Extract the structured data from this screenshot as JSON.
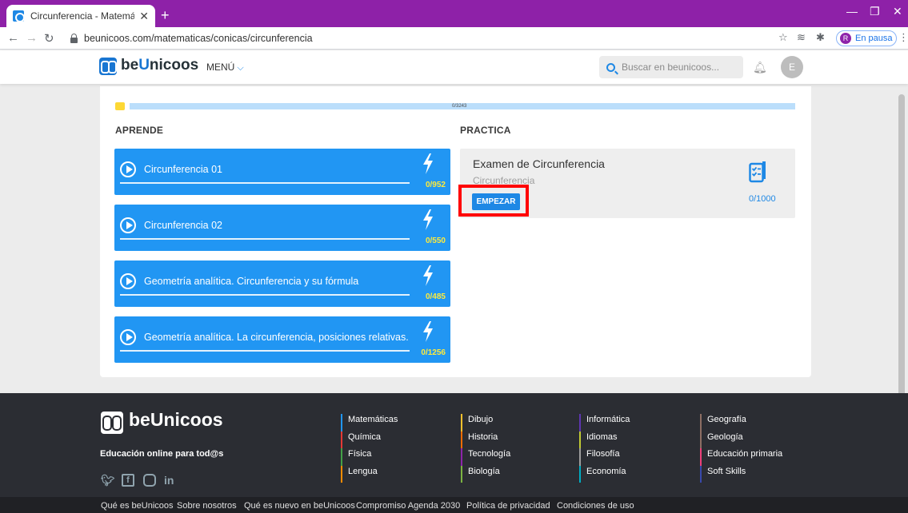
{
  "browser": {
    "tab_title": "Circunferencia - Matemáticas - C",
    "url": "beunicoos.com/matematicas/conicas/circunferencia",
    "profile_label": "En pausa",
    "profile_initial": "R"
  },
  "header": {
    "logo_prefix": "be",
    "logo_u": "U",
    "logo_suffix": "nicoos",
    "menu_label": "MENÚ",
    "search_placeholder": "Buscar en beunicoos...",
    "avatar_initial": "E"
  },
  "progress": {
    "text": "0/3243",
    "value": 0,
    "max": 3243
  },
  "learn": {
    "title": "APRENDE",
    "lessons": [
      {
        "title": "Circunferencia 01",
        "count": "0/952"
      },
      {
        "title": "Circunferencia 02",
        "count": "0/550"
      },
      {
        "title": "Geometría analítica. Circunferencia y su fórmula",
        "count": "0/485"
      },
      {
        "title": "Geometría analítica. La circunferencia, posiciones relativas.",
        "count": "0/1256"
      }
    ]
  },
  "practice": {
    "title": "PRACTICA",
    "exam": {
      "title": "Examen de Circunferencia",
      "subtitle": "Circunferencia",
      "button": "EMPEZAR",
      "count": "0/1000"
    }
  },
  "footer": {
    "logo_text": "beUnicoos",
    "tagline": "Educación online para tod@s",
    "columns": [
      {
        "links": [
          {
            "label": "Matemáticas",
            "color": "#2196f3"
          },
          {
            "label": "Química",
            "color": "#e53935"
          },
          {
            "label": "Física",
            "color": "#43a047"
          },
          {
            "label": "Lengua",
            "color": "#fb8c00"
          }
        ]
      },
      {
        "links": [
          {
            "label": "Dibujo",
            "color": "#fbc02d"
          },
          {
            "label": "Historia",
            "color": "#ef6c00"
          },
          {
            "label": "Tecnología",
            "color": "#8e24aa"
          },
          {
            "label": "Biología",
            "color": "#7cb342"
          }
        ]
      },
      {
        "links": [
          {
            "label": "Informática",
            "color": "#5e35b1"
          },
          {
            "label": "Idiomas",
            "color": "#c0ca33"
          },
          {
            "label": "Filosofía",
            "color": "#9e9e9e"
          },
          {
            "label": "Economía",
            "color": "#00acc1"
          }
        ]
      },
      {
        "links": [
          {
            "label": "Geografía",
            "color": "#8d6e63"
          },
          {
            "label": "Geología",
            "color": "#8d6e63"
          },
          {
            "label": "Educación primaria",
            "color": "#ec407a"
          },
          {
            "label": "Soft Skills",
            "color": "#3949ab"
          }
        ]
      }
    ],
    "bottom_links": [
      "Qué es beUnicoos",
      "Sobre nosotros",
      "Qué es nuevo en beUnicoos",
      "Compromiso Agenda 2030",
      "Política de privacidad",
      "Condiciones de uso"
    ]
  },
  "colors": {
    "chrome": "#8e21a8",
    "accent": "#2196f3",
    "footer": "#2b2d33",
    "highlight": "#ff0000"
  }
}
